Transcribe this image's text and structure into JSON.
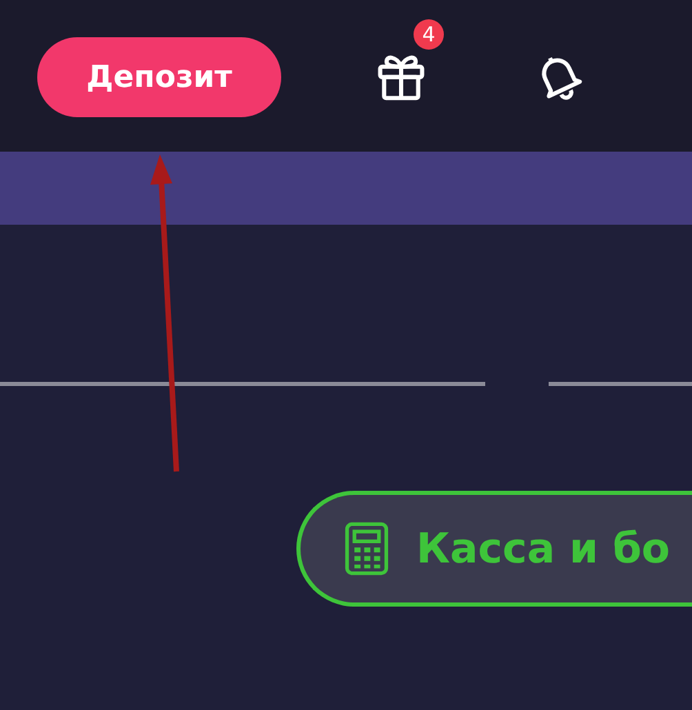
{
  "header": {
    "deposit_button": "Депозит",
    "gift_badge": "4"
  },
  "cashier_button": {
    "label": "Касса и бо"
  }
}
